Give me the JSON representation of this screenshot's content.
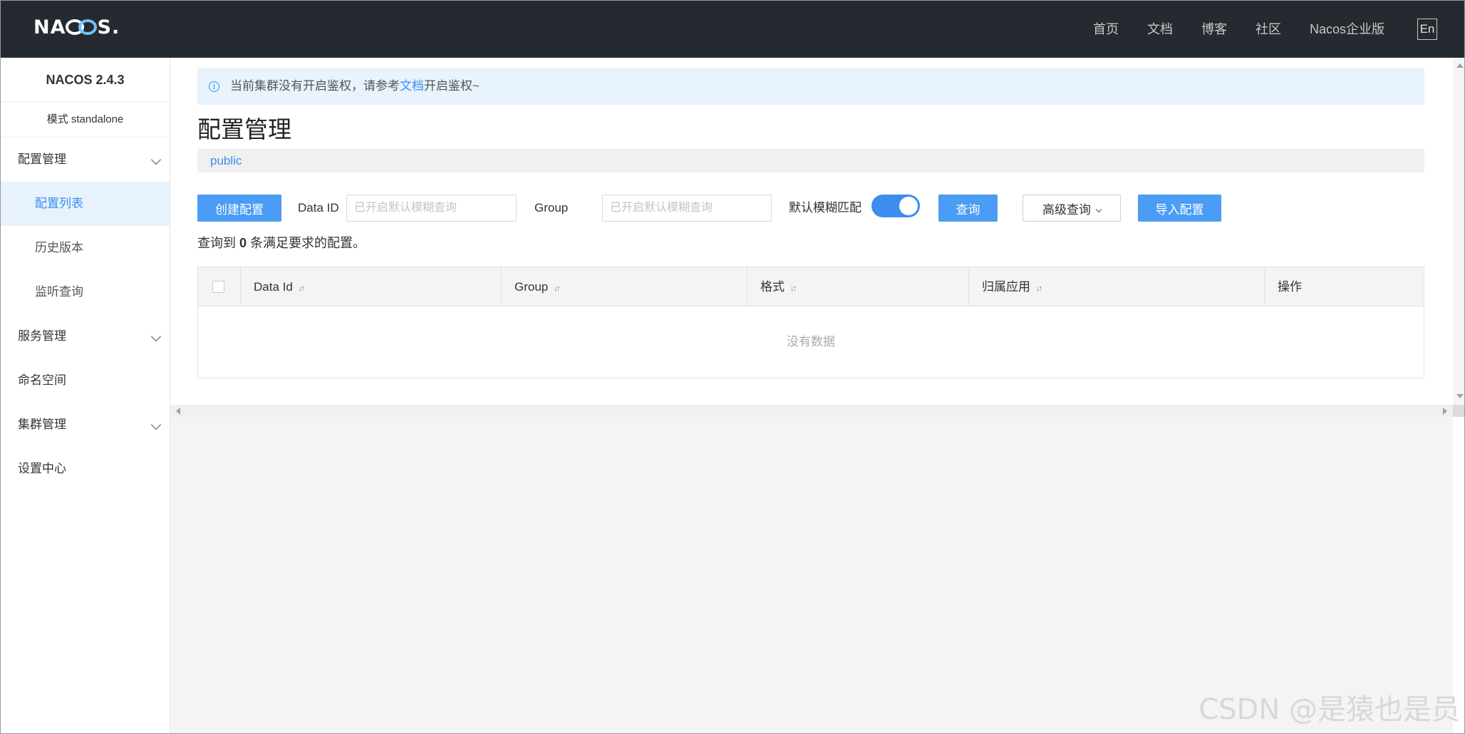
{
  "header": {
    "logo_left": "NA",
    "logo_right": "S.",
    "nav": [
      "首页",
      "文档",
      "博客",
      "社区",
      "Nacos企业版"
    ],
    "lang_button": "En"
  },
  "sidebar": {
    "version": "NACOS 2.4.3",
    "mode": "模式 standalone",
    "items": [
      {
        "label": "配置管理",
        "expandable": true
      },
      {
        "label": "配置列表",
        "active": true,
        "sub": true
      },
      {
        "label": "历史版本",
        "sub": true
      },
      {
        "label": "监听查询",
        "sub": true
      },
      {
        "label": "服务管理",
        "expandable": true
      },
      {
        "label": "命名空间"
      },
      {
        "label": "集群管理",
        "expandable": true
      },
      {
        "label": "设置中心"
      }
    ]
  },
  "alert": {
    "before": "当前集群没有开启鉴权，请参考",
    "link": "文档",
    "after": "开启鉴权~"
  },
  "page": {
    "title": "配置管理",
    "namespace": "public"
  },
  "toolbar": {
    "create_button": "创建配置",
    "data_id_label": "Data ID",
    "data_id_placeholder": "已开启默认模糊查询",
    "group_label": "Group",
    "group_placeholder": "已开启默认模糊查询",
    "fuzzy_label": "默认模糊匹配",
    "fuzzy_enabled": true,
    "search_button": "查询",
    "advanced_button": "高级查询",
    "import_button": "导入配置"
  },
  "result": {
    "prefix": "查询到",
    "count": "0",
    "suffix": "条满足要求的配置。"
  },
  "table": {
    "columns": [
      "Data Id",
      "Group",
      "格式",
      "归属应用",
      "操作"
    ],
    "empty_text": "没有数据"
  },
  "watermark": "CSDN @是猿也是员",
  "colors": {
    "topbar": "#252a30",
    "accent": "#3b8ef0",
    "button": "#4a9cf4",
    "alert_bg": "#e8f3fd"
  }
}
